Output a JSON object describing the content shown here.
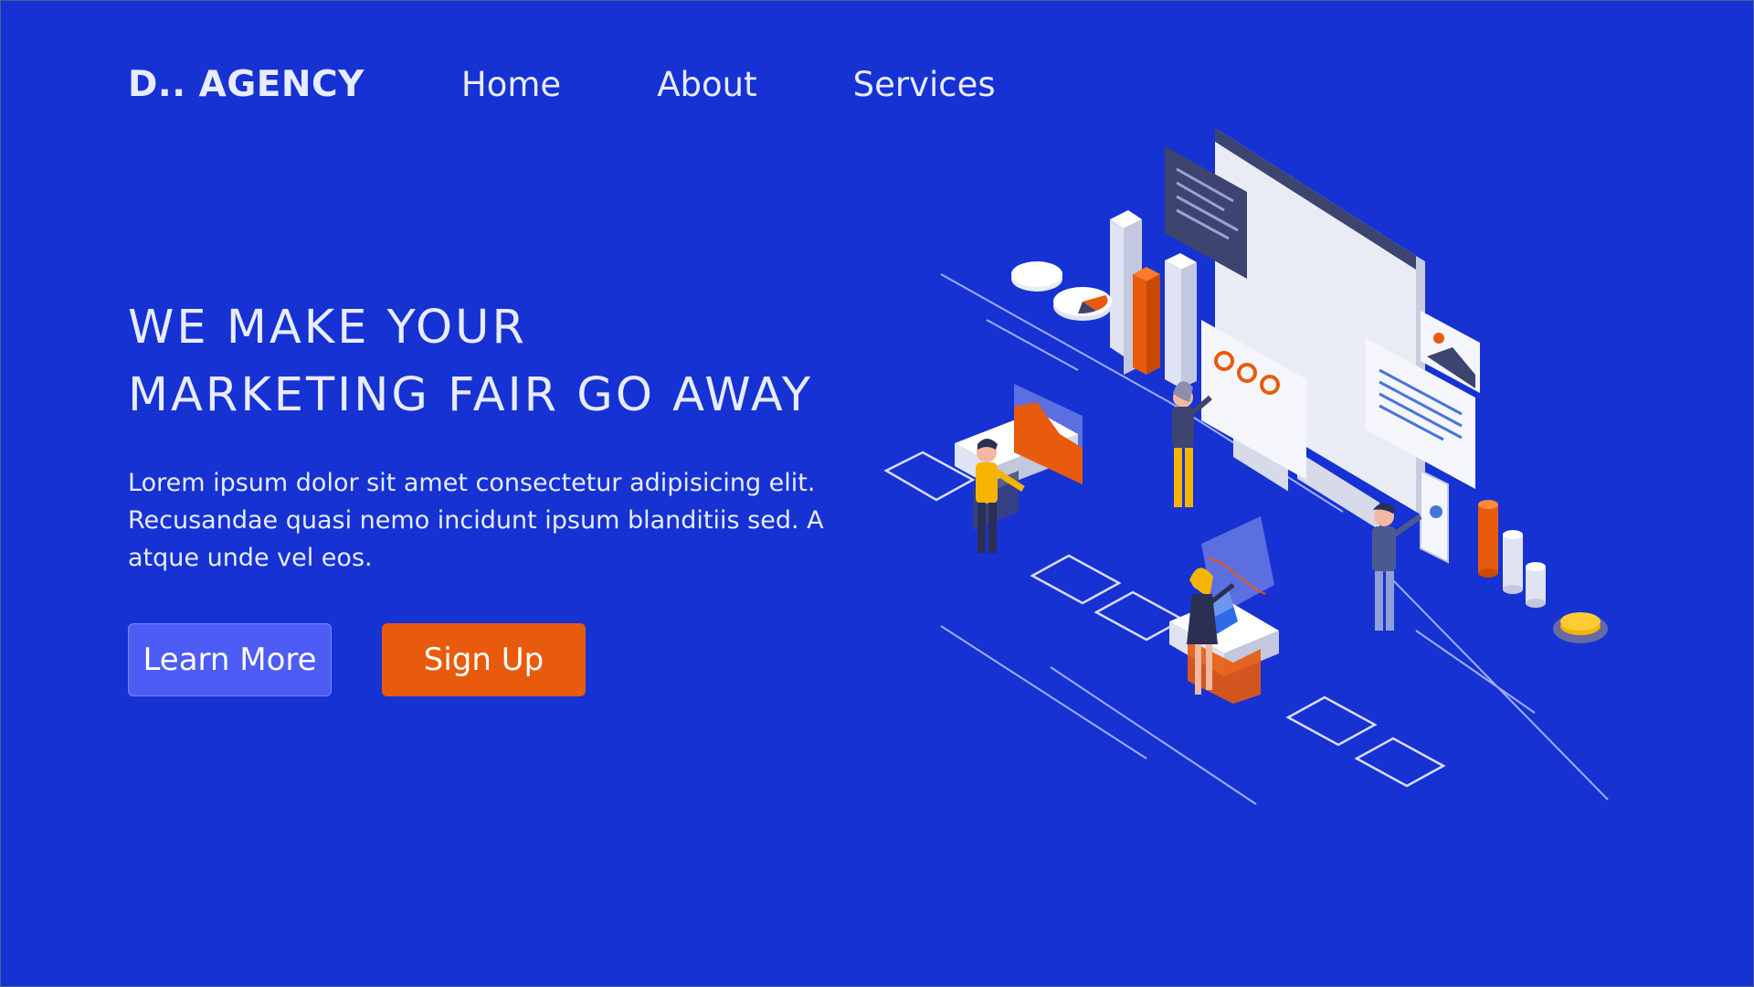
{
  "header": {
    "logo": "D.. AGENCY",
    "nav": [
      {
        "label": "Home"
      },
      {
        "label": "About"
      },
      {
        "label": "Services"
      }
    ]
  },
  "hero": {
    "title_line1": "WE MAKE YOUR",
    "title_line2": "MARKETING FAIR GO AWAY",
    "description": "Lorem ipsum dolor sit amet consectetur adipisicing elit. Recusandae quasi nemo incidunt ipsum blanditiis sed. A atque unde vel eos.",
    "buttons": {
      "learn_more": "Learn More",
      "sign_up": "Sign Up"
    }
  },
  "colors": {
    "background": "#1632d3",
    "primary_button": "#4c5cf4",
    "accent_button": "#e85a0c",
    "text": "#e8ecff"
  },
  "illustration": {
    "name": "isometric-marketing-team-illustration"
  }
}
